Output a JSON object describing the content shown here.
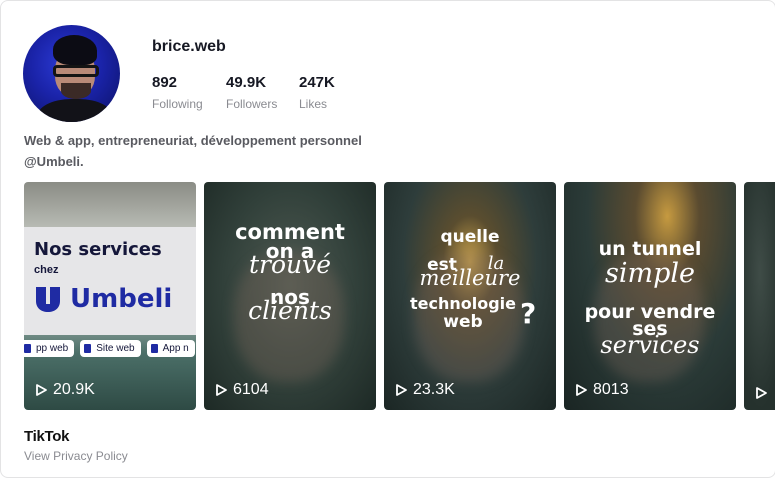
{
  "profile": {
    "username": "brice.web",
    "stats": [
      {
        "value": "892",
        "label": "Following"
      },
      {
        "value": "49.9K",
        "label": "Followers"
      },
      {
        "value": "247K",
        "label": "Likes"
      }
    ],
    "bio_line1": "Web & app, entrepreneuriat, développement personnel",
    "bio_line2": "@Umbeli."
  },
  "videos": [
    {
      "views": "20.9K",
      "title": "Nos services",
      "subtitle": "chez",
      "brand": "Umbeli",
      "chips": [
        "pp web",
        "Site web",
        "App n"
      ]
    },
    {
      "views": "6104",
      "lines": [
        "comment",
        "on a",
        "trouvé",
        "nos",
        "clients"
      ]
    },
    {
      "views": "23.3K",
      "lines": [
        "quelle",
        "est",
        "la",
        "meilleure",
        "technologie",
        "web",
        "?"
      ]
    },
    {
      "views": "8013",
      "lines": [
        "un tunnel",
        "simple",
        "pour vendre",
        "ses",
        "services"
      ]
    },
    {
      "views": "",
      "lines": []
    }
  ],
  "footer": {
    "brand": "TikTok",
    "privacy_link": "View Privacy Policy"
  },
  "colors": {
    "avatar_bg": "#1a23a8",
    "brand_blue": "#1f2ba3",
    "muted_text": "#8a8b91"
  },
  "icons": [
    "play-icon",
    "umbeli-logo-icon"
  ]
}
